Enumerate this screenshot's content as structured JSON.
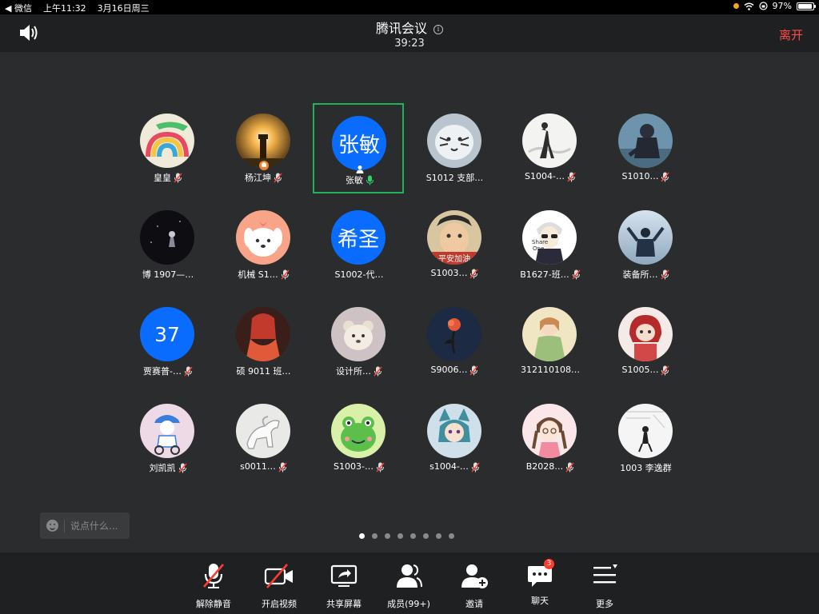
{
  "statusbar": {
    "back_app": "◀ 微信",
    "time": "上午11:32",
    "date": "3月16日周三",
    "battery": "97%",
    "battery_level": 0.97
  },
  "header": {
    "title": "腾讯会议",
    "timer": "39:23",
    "leave_label": "离开"
  },
  "participants": [
    {
      "name": "皇皇",
      "avatar": "rainbow",
      "muted": true
    },
    {
      "name": "杨江坤",
      "avatar": "sunset-lighthouse",
      "muted": true,
      "host": true
    },
    {
      "name": "张敏",
      "avatar_text": "张敏",
      "muted": false,
      "speaking": true,
      "self": true
    },
    {
      "name": "S1012 支部…",
      "avatar": "white-tiger",
      "muted": false
    },
    {
      "name": "S1004-…",
      "avatar": "ink-painting",
      "muted": true
    },
    {
      "name": "S1010…",
      "avatar": "anime-warrior",
      "muted": true
    },
    {
      "name": "博 1907—…",
      "avatar": "dark-night",
      "muted": false
    },
    {
      "name": "机械 S1…",
      "avatar": "cartoon-dog",
      "muted": true
    },
    {
      "name": "S1002-代…",
      "avatar_text": "希圣",
      "muted": false
    },
    {
      "name": "S1003…",
      "avatar": "jojo-face",
      "muted": true
    },
    {
      "name": "B1627-班…",
      "avatar": "share-one-boy",
      "muted": true
    },
    {
      "name": "装备所…",
      "avatar": "sky-person",
      "muted": true
    },
    {
      "name": "贾赛普-…",
      "avatar_text": "37",
      "muted": true
    },
    {
      "name": "硕 9011 班…",
      "avatar": "red-girl",
      "muted": false
    },
    {
      "name": "设计所…",
      "avatar": "teddy-bear",
      "muted": true
    },
    {
      "name": "S9006…",
      "avatar": "dark-rose",
      "muted": true
    },
    {
      "name": "312110108…",
      "avatar": "anime-girl",
      "muted": false
    },
    {
      "name": "S1005…",
      "avatar": "red-hair-chibi",
      "muted": true
    },
    {
      "name": "刘凯凯",
      "avatar": "blue-cap-kid",
      "muted": true
    },
    {
      "name": "s0011…",
      "avatar": "white-horse",
      "muted": true
    },
    {
      "name": "S1003-…",
      "avatar": "green-frog",
      "muted": true
    },
    {
      "name": "s1004-…",
      "avatar": "anime-cat-girl",
      "muted": true
    },
    {
      "name": "B2028…",
      "avatar": "braids-girl",
      "muted": true
    },
    {
      "name": "1003 李逸群",
      "avatar": "sketch-figure",
      "muted": false
    }
  ],
  "chat": {
    "placeholder": "说点什么..."
  },
  "pager": {
    "pages": 8,
    "current": 1
  },
  "toolbar": {
    "unmute": "解除静音",
    "video": "开启视频",
    "share": "共享屏幕",
    "members": "成员(99+)",
    "invite": "邀请",
    "chat": "聊天",
    "chat_badge": "3",
    "more": "更多"
  }
}
